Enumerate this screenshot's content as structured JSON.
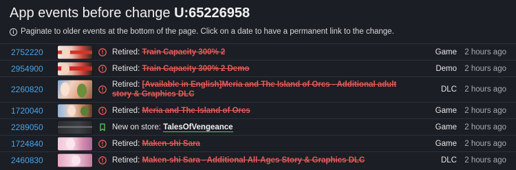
{
  "header": {
    "title_prefix": "App events before change",
    "title_change": "U:65226958",
    "info_text": "Paginate to older events at the bottom of the page. Click on a date to have a permanent link to the change."
  },
  "colors": {
    "accent_link": "#4aa3e8",
    "retired_red": "#e85a5a",
    "new_green": "#5ac85a"
  },
  "events": [
    {
      "appid": "2752220",
      "icon": "alert-circle-icon",
      "action": "Retired:",
      "name": "Train Capacity 300% 2",
      "status": "retired",
      "type": "Game",
      "time": "2 hours ago"
    },
    {
      "appid": "2954900",
      "icon": "alert-circle-icon",
      "action": "Retired:",
      "name": "Train Capacity 300% 2 Demo",
      "status": "retired",
      "type": "Demo",
      "time": "2 hours ago"
    },
    {
      "appid": "2260820",
      "icon": "alert-circle-icon",
      "action": "Retired:",
      "name": "[Available in English]Meria and The Island of Orcs - Additional adult story & Graphics DLC",
      "status": "retired",
      "type": "DLC",
      "time": "2 hours ago"
    },
    {
      "appid": "1720040",
      "icon": "alert-circle-icon",
      "action": "Retired:",
      "name": "Meria and The Island of Orcs",
      "status": "retired",
      "type": "Game",
      "time": "2 hours ago"
    },
    {
      "appid": "2289050",
      "icon": "bookmark-icon",
      "action": "New on store:",
      "name": "TalesOfVengeance",
      "status": "new",
      "type": "Game",
      "time": "2 hours ago"
    },
    {
      "appid": "1724840",
      "icon": "alert-circle-icon",
      "action": "Retired:",
      "name": "Maken-shi Sara",
      "status": "retired",
      "type": "Game",
      "time": "2 hours ago"
    },
    {
      "appid": "2460830",
      "icon": "alert-circle-icon",
      "action": "Retired:",
      "name": "Maken-shi Sara - Additional All-Ages Story & Graphics DLC",
      "status": "retired",
      "type": "DLC",
      "time": "2 hours ago"
    }
  ]
}
